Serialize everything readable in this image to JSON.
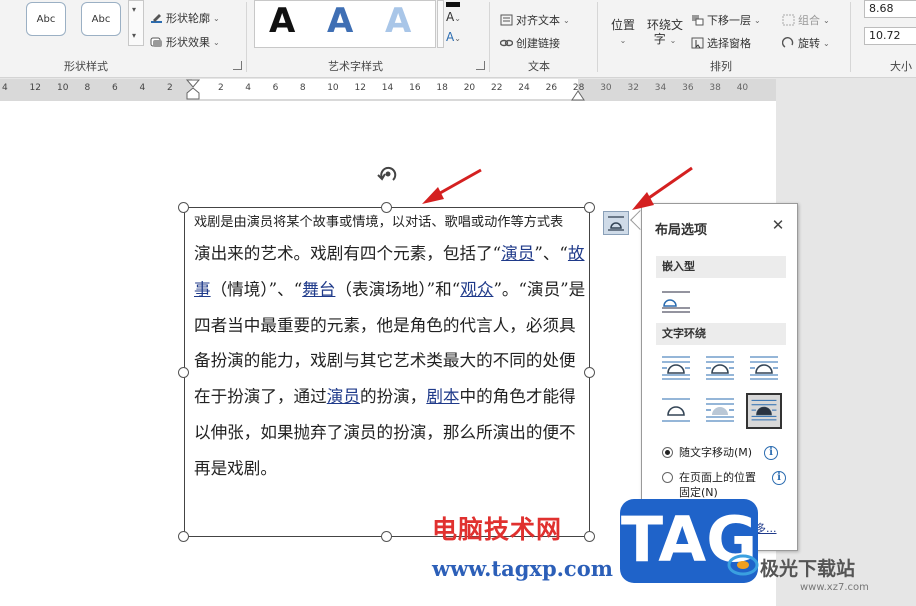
{
  "ribbon": {
    "shape_styles": {
      "label": "形状样式",
      "thumbs": [
        "Abc",
        "Abc"
      ],
      "outline_label": "形状轮廓",
      "effects_label": "形状效果"
    },
    "art_styles": {
      "label": "艺术字样式",
      "samples": [
        "A",
        "A",
        "A"
      ]
    },
    "text": {
      "label": "文本",
      "align_text_label": "对齐文本",
      "create_link_label": "创建链接"
    },
    "arrange": {
      "label": "排列",
      "position_label": "位置",
      "wrap_text_label_1": "环绕文",
      "wrap_text_label_2": "字",
      "send_backward_label": "下移一层",
      "selection_pane_label": "选择窗格",
      "group_label": "组合",
      "rotate_label": "旋转"
    },
    "size": {
      "label": "大小",
      "height_value": "8.68",
      "width_value": "10.72"
    }
  },
  "ruler": {
    "left_ticks": [
      "4",
      "12",
      "10",
      "8",
      "6",
      "4",
      "2"
    ],
    "right_ticks": [
      "2",
      "4",
      "6",
      "8",
      "10",
      "12",
      "14",
      "16",
      "18",
      "20",
      "22",
      "24",
      "26",
      "28",
      "30",
      "32",
      "34",
      "36",
      "38",
      "40"
    ]
  },
  "textbox": {
    "line1": "戏剧是由演员将某个故事或情境，以对话、歌唱或动作等方式表",
    "p_a": "演出来的艺术。戏剧有四个元素，包括了“",
    "link_actor": "演员",
    "p_b": "”、“",
    "link_story": "故事",
    "p_c": "（情境）”、“",
    "link_stage": "舞台",
    "p_d": "（表演场地）”和“",
    "link_audience": "观众",
    "p_e": "”。“演员”是四者当中最重要的元素，他是角色的代言人，必须具备扮演的能力，戏剧与其它艺术类最大的不同的处便在于扮演了，通过",
    "link_actor2": "演员",
    "p_f": "的扮演，",
    "link_script": "剧本",
    "p_g": "中的角色才能得以伸张，如果抛弃了演员的扮演，那么所演出的便不再是戏剧。"
  },
  "layout_panel": {
    "title": "布局选项",
    "close_glyph": "✕",
    "section_inline": "嵌入型",
    "section_wrap": "文字环绕",
    "radio_move": "随文字移动(M)",
    "radio_fixed_1": "在页面上的位置",
    "radio_fixed_2": "固定(N)",
    "info_glyph": "i",
    "see_more": "查看更多..."
  },
  "watermark": {
    "site_cn": "电脑技术网",
    "site_url": "www.tagxp.com",
    "tag": "TAG",
    "xz_cn": "极光下载站",
    "xz_url": "www.xz7.com"
  },
  "colors": {
    "link": "#1f3a8a",
    "arrow": "#d42020",
    "tag_blue": "#1f63c9",
    "wm_red": "#e0312f"
  }
}
